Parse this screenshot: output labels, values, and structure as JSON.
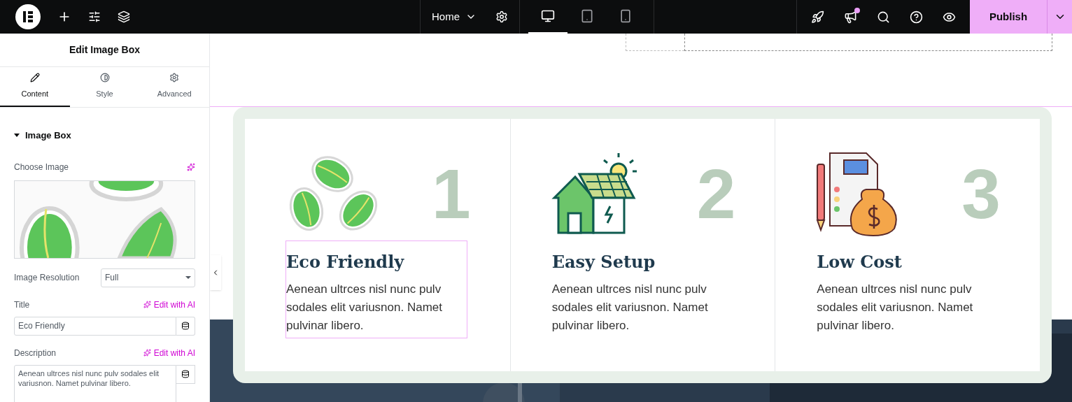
{
  "topbar": {
    "page": "Home",
    "devices": [
      {
        "kind": "desktop",
        "selected": true
      },
      {
        "kind": "tablet",
        "selected": false
      },
      {
        "kind": "mobile",
        "selected": false
      }
    ],
    "notification": true,
    "publish": "Publish"
  },
  "panel": {
    "title": "Edit Image Box",
    "tabs": [
      {
        "label": "Content",
        "kind": "pencil",
        "selected": true
      },
      {
        "label": "Style",
        "kind": "contrast",
        "selected": false
      },
      {
        "label": "Advanced",
        "kind": "gear",
        "selected": false
      }
    ],
    "section": {
      "title": "Image Box",
      "expanded": true
    },
    "choose_image": "Choose Image",
    "resolution": {
      "label": "Image Resolution",
      "value": "Full"
    },
    "title_field": {
      "label": "Title",
      "ai": "Edit with AI",
      "value": "Eco Friendly"
    },
    "description_field": {
      "label": "Description",
      "ai": "Edit with AI",
      "value": "Aenean ultrces nisl nunc pulv sodales elit variusnon. Namet pulvinar libero."
    }
  },
  "features": [
    {
      "kind": "recycle",
      "number": "1",
      "title": "Eco Friendly",
      "description": "Aenean ultrces nisl nunc pulv sodales elit variusnon. Namet pulvinar libero.",
      "selected": true
    },
    {
      "kind": "solar-house",
      "number": "2",
      "title": "Easy Setup",
      "description": "Aenean ultrces nisl nunc pulv sodales elit variusnon. Namet pulvinar libero.",
      "selected": false
    },
    {
      "kind": "savings",
      "number": "3",
      "title": "Low Cost",
      "description": "Aenean ultrces nisl nunc pulv sodales elit variusnon. Namet pulvinar libero.",
      "selected": false
    }
  ]
}
